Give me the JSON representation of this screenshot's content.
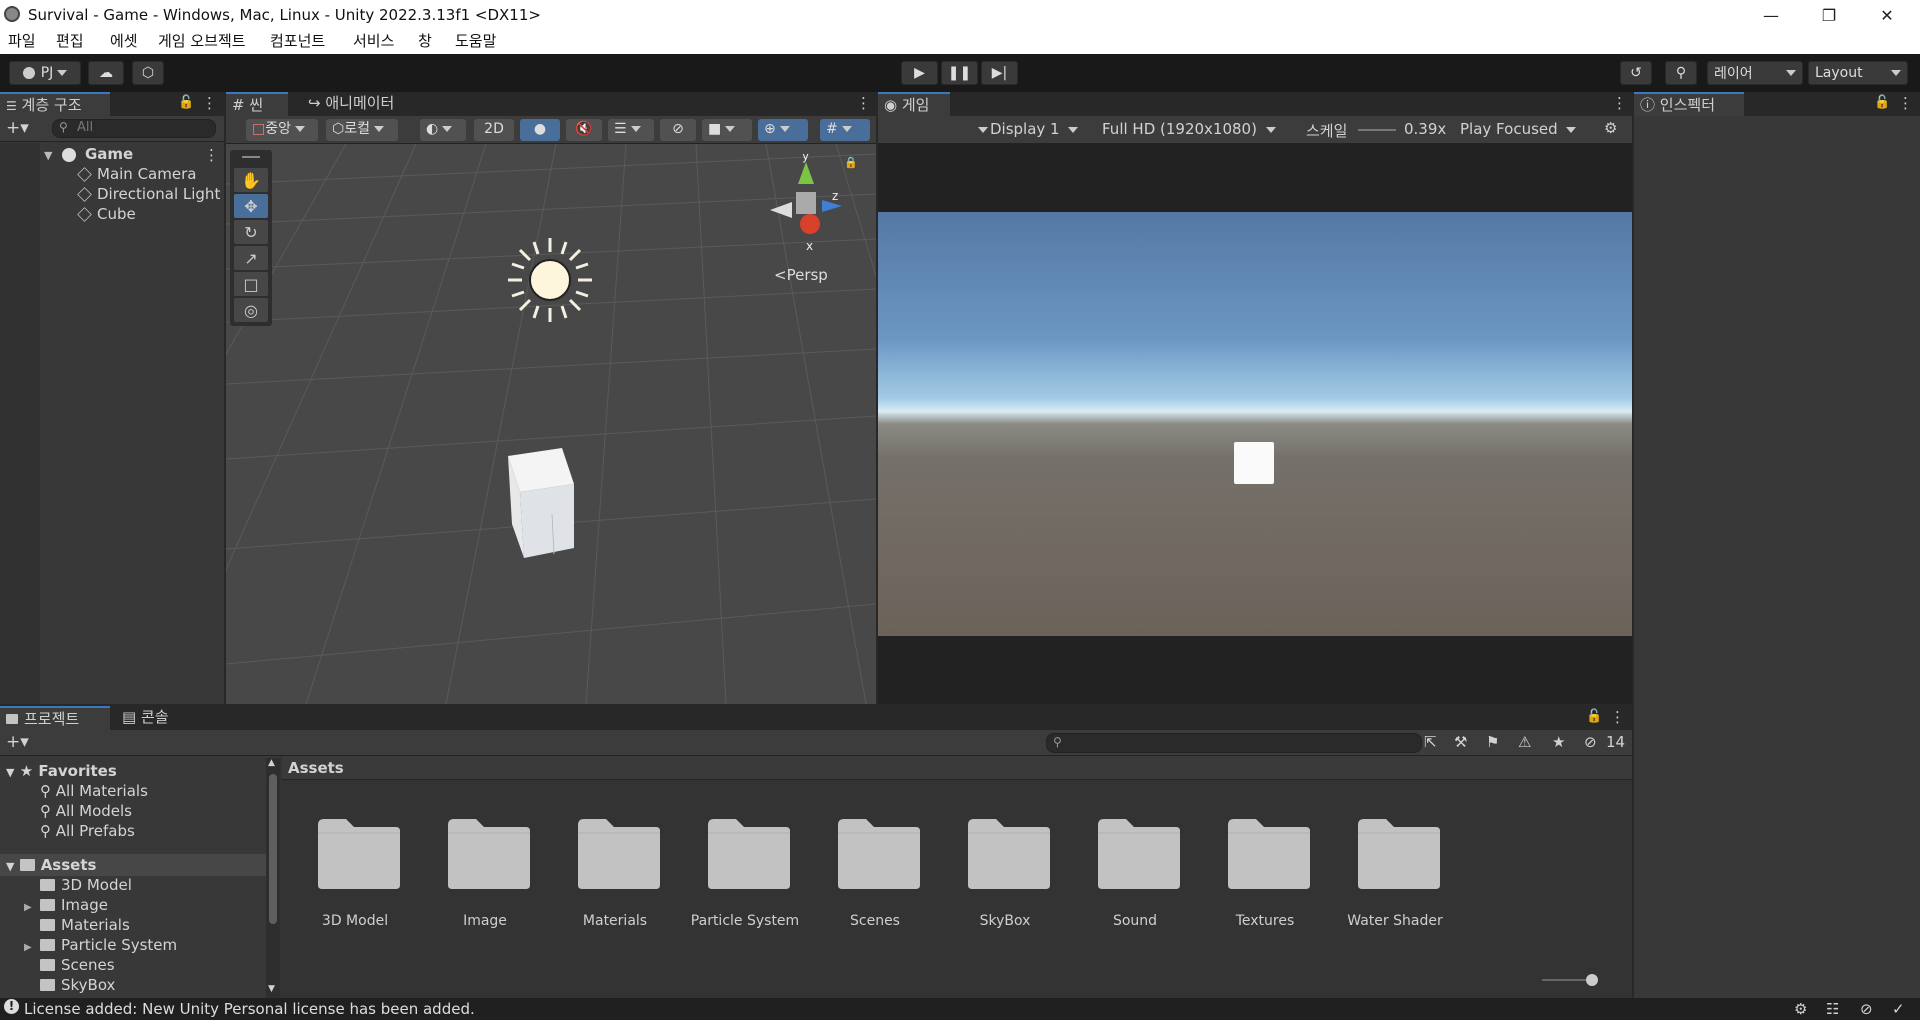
{
  "window": {
    "title": "Survival - Game - Windows, Mac, Linux - Unity 2022.3.13f1 <DX11>",
    "min_icon": "minimize-icon",
    "max_icon": "restore-icon",
    "close_icon": "close-icon"
  },
  "menu": [
    "파일",
    "편집",
    "에셋",
    "게임 오브젝트",
    "컴포넌트",
    "서비스",
    "창",
    "도움말"
  ],
  "toolbar": {
    "account": "PJ",
    "layers": "레이어",
    "layout": "Layout"
  },
  "hierarchy": {
    "tab": "계층 구조",
    "search_placeholder": "All",
    "scene": "Game",
    "items": [
      "Main Camera",
      "Directional Light",
      "Cube"
    ]
  },
  "scene_view": {
    "tab_scene": "씬",
    "tab_animator": "애니메이터",
    "pivot": "중앙",
    "space": "로컬",
    "mode_2d": "2D",
    "persp": "Persp",
    "axis_x": "x",
    "axis_y": "y",
    "axis_z": "z"
  },
  "game_view": {
    "tab": "게임",
    "display": "Display 1",
    "resolution": "Full HD (1920x1080)",
    "scale_label": "스케일",
    "scale_value": "0.39x",
    "play_mode": "Play Focused"
  },
  "inspector": {
    "tab": "인스펙터"
  },
  "project": {
    "tab_project": "프로젝트",
    "tab_console": "콘솔",
    "hidden_count": "14",
    "breadcrumb": "Assets",
    "favorites": {
      "label": "Favorites",
      "items": [
        "All Materials",
        "All Models",
        "All Prefabs"
      ]
    },
    "assets_root": "Assets",
    "tree": [
      {
        "label": "3D Model",
        "expand": false
      },
      {
        "label": "Image",
        "expand": true
      },
      {
        "label": "Materials",
        "expand": false
      },
      {
        "label": "Particle System",
        "expand": true
      },
      {
        "label": "Scenes",
        "expand": false
      },
      {
        "label": "SkyBox",
        "expand": false
      }
    ],
    "folders": [
      "3D Model",
      "Image",
      "Materials",
      "Particle System",
      "Scenes",
      "SkyBox",
      "Sound",
      "Textures",
      "Water Shader"
    ]
  },
  "status": {
    "message": "License added: New Unity Personal license has been added."
  }
}
